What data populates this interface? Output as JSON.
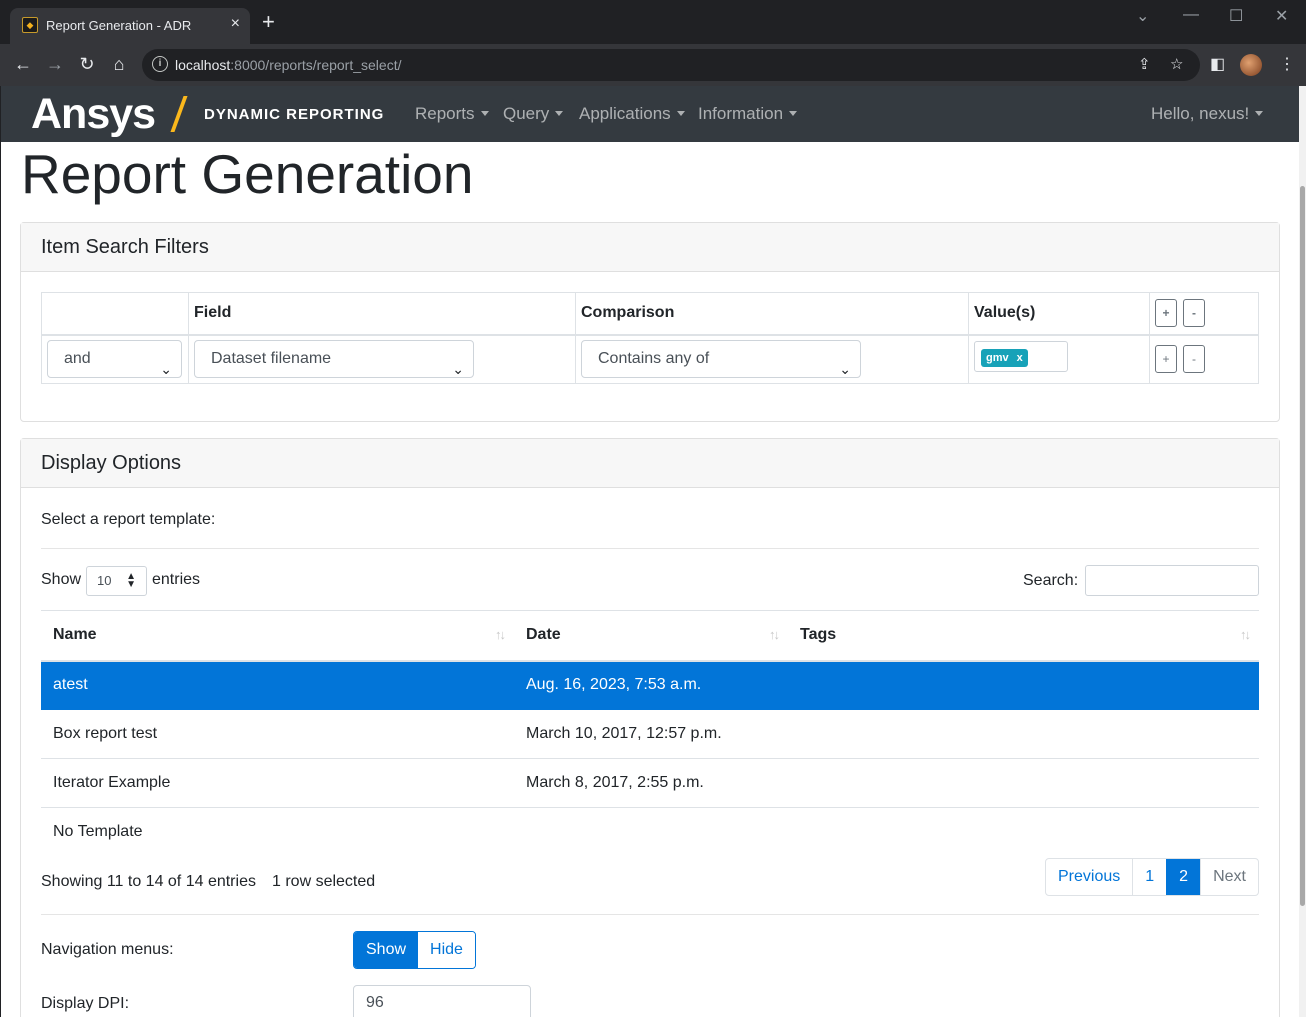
{
  "browser": {
    "tab_title": "Report Generation - ADR",
    "tab_close": "×",
    "new_tab": "+",
    "url_host": "localhost",
    "url_path": ":8000/reports/report_select/"
  },
  "app": {
    "brand": "Ansys",
    "brand_sub": "DYNAMIC REPORTING",
    "menus": [
      "Reports",
      "Query",
      "Applications",
      "Information"
    ],
    "user_menu": "Hello, nexus!"
  },
  "page": {
    "title": "Report Generation"
  },
  "filters": {
    "header": "Item Search Filters",
    "columns": [
      "",
      "Field",
      "Comparison",
      "Value(s)"
    ],
    "add_label": "+",
    "remove_label": "-",
    "row": {
      "logic": "and",
      "field": "Dataset filename",
      "comparison": "Contains any of",
      "value_token": "gmv",
      "token_remove": "x"
    }
  },
  "display": {
    "header": "Display Options",
    "select_template_label": "Select a report template:",
    "show_label": "Show",
    "entries_value": "10",
    "entries_label": "entries",
    "search_label": "Search:",
    "columns": [
      "Name",
      "Date",
      "Tags"
    ],
    "rows": [
      {
        "name": "atest",
        "date": "Aug. 16, 2023, 7:53 a.m.",
        "tags": "",
        "selected": true
      },
      {
        "name": "Box report test",
        "date": "March 10, 2017, 12:57 p.m.",
        "tags": "",
        "selected": false
      },
      {
        "name": "Iterator Example",
        "date": "March 8, 2017, 2:55 p.m.",
        "tags": "",
        "selected": false
      },
      {
        "name": "No Template",
        "date": "",
        "tags": "",
        "selected": false
      }
    ],
    "info": "Showing 11 to 14 of 14 entries",
    "selected_info": "1 row selected",
    "pagination": [
      "Previous",
      "1",
      "2",
      "Next"
    ],
    "nav_menus_label": "Navigation menus:",
    "nav_show": "Show",
    "nav_hide": "Hide",
    "dpi_label": "Display DPI:",
    "dpi_value": "96"
  },
  "colors": {
    "brand_accent": "#fbb81c",
    "navbar": "#343a40",
    "primary": "#0275d8",
    "token": "#17a2b8"
  }
}
